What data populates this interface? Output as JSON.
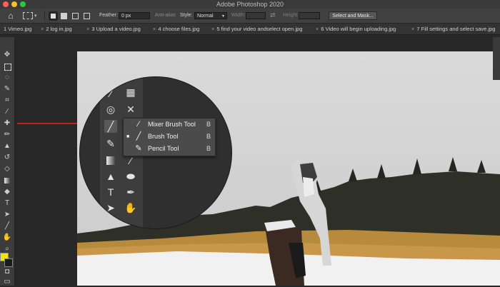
{
  "window": {
    "title": "Adobe Photoshop 2020"
  },
  "options_bar": {
    "feather_label": "Feather:",
    "feather_value": "0 px",
    "anti_alias_label": "Anti-alias",
    "style_label": "Style:",
    "style_value": "Normal",
    "width_label": "Width:",
    "height_label": "Height:",
    "select_and_mask": "Select and Mask..."
  },
  "tabs": [
    {
      "label": "1 Vimeo.jpg"
    },
    {
      "label": "2 log in.jpg"
    },
    {
      "label": "3 Upload a video.jpg"
    },
    {
      "label": "4 choose files.jpg"
    },
    {
      "label": "5 find your video andselect open.jpg"
    },
    {
      "label": "6 Video will begin uploading.jpg"
    },
    {
      "label": "7 Fill settings and select save.jpg"
    }
  ],
  "tab_close_glyph": "×",
  "toolbar_icons": [
    "move-icon",
    "marquee-icon",
    "lasso-icon",
    "quick-select-icon",
    "crop-icon",
    "eyedropper-icon",
    "healing-icon",
    "brush-icon",
    "stamp-icon",
    "history-brush-icon",
    "eraser-icon",
    "gradient-icon",
    "blur-icon",
    "dodge-icon",
    "pen-icon",
    "type-icon",
    "path-select-icon",
    "shape-icon",
    "hand-icon",
    "zoom-icon",
    "more-icon"
  ],
  "flyout": {
    "items": [
      {
        "label": "Mixer Brush Tool",
        "shortcut": "B",
        "icon": "mixer-brush-icon"
      },
      {
        "label": "Brush Tool",
        "shortcut": "B",
        "icon": "brush-icon",
        "active": true
      },
      {
        "label": "Pencil Tool",
        "shortcut": "B",
        "icon": "pencil-icon"
      }
    ]
  },
  "colors": {
    "arrow": "#c8201e",
    "foreground_swatch": "#f5e600",
    "background_swatch": "#1a1a1a"
  }
}
